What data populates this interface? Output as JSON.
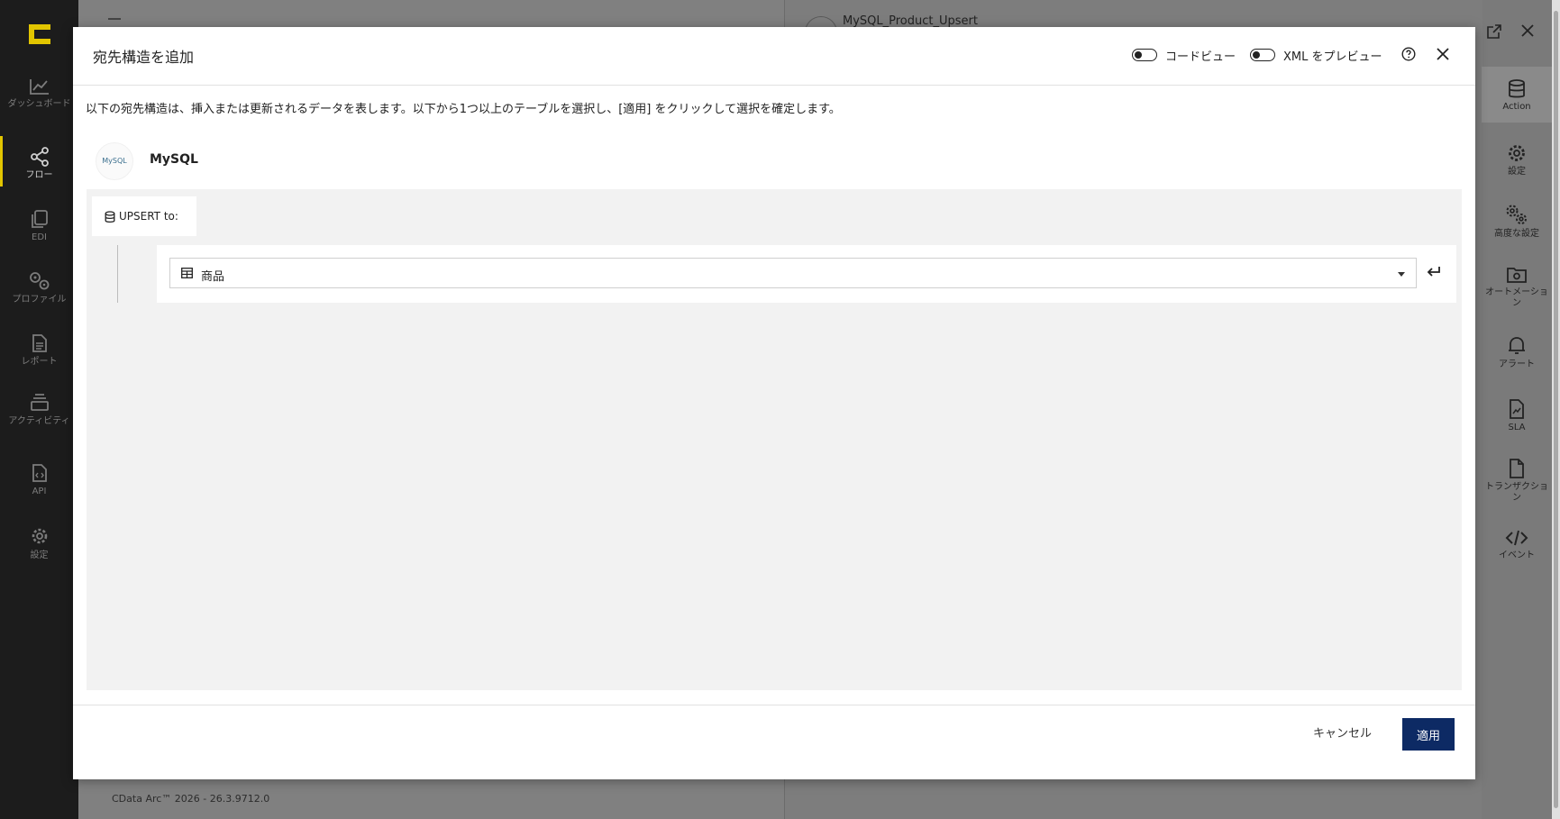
{
  "sidebar": {
    "items": [
      {
        "label": "ダッシュボード",
        "icon": "chart-line-icon"
      },
      {
        "label": "フロー",
        "icon": "share-nodes-icon",
        "active": true
      },
      {
        "label": "EDI",
        "icon": "copy-icon"
      },
      {
        "label": "プロファイル",
        "icon": "gears-icon"
      },
      {
        "label": "レポート",
        "icon": "file-lines-icon"
      },
      {
        "label": "アクティビティ",
        "icon": "layers-icon"
      },
      {
        "label": "API",
        "icon": "file-code-icon"
      },
      {
        "label": "設定",
        "icon": "gear-icon"
      }
    ]
  },
  "background": {
    "connector_title": "MySQL_Product_Upsert",
    "version": "CData Arc™ 2026 - 26.3.9712.0"
  },
  "right_panel": {
    "items": [
      {
        "label": "Action",
        "icon": "database-icon"
      },
      {
        "label": "設定",
        "icon": "gear-icon"
      },
      {
        "label": "高度な設定",
        "icon": "gears-icon"
      },
      {
        "label": "オートメーション",
        "icon": "folder-gear-icon"
      },
      {
        "label": "アラート",
        "icon": "bell-icon"
      },
      {
        "label": "SLA",
        "icon": "file-chart-icon"
      },
      {
        "label": "トランザクション",
        "icon": "file-icon"
      },
      {
        "label": "イベント",
        "icon": "code-icon"
      }
    ]
  },
  "modal": {
    "title": "宛先構造を追加",
    "code_view_label": "コードビュー",
    "xml_preview_label": "XML をプレビュー",
    "description": "以下の宛先構造は、挿入または更新されるデータを表します。以下から1つ以上のテーブルを選択し、[適用] をクリックして選択を確定します。",
    "db_name": "MySQL",
    "db_logo_text": "MySQL",
    "upsert_label": "UPSERT to:",
    "table_select_value": "商品",
    "cancel_label": "キャンセル",
    "apply_label": "適用"
  },
  "colors": {
    "accent": "#e2c500",
    "apply_button": "#0d2a64"
  }
}
